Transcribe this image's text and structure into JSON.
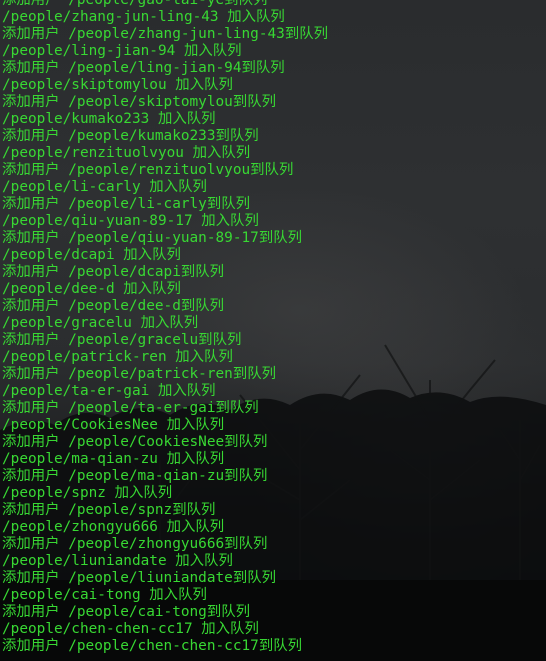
{
  "terminal": {
    "text_color": "#38d833",
    "lines": [
      "添加用户 /people/gao-tai-ye到队列",
      "/people/zhang-jun-ling-43 加入队列",
      "添加用户 /people/zhang-jun-ling-43到队列",
      "/people/ling-jian-94 加入队列",
      "添加用户 /people/ling-jian-94到队列",
      "/people/skiptomylou 加入队列",
      "添加用户 /people/skiptomylou到队列",
      "/people/kumako233 加入队列",
      "添加用户 /people/kumako233到队列",
      "/people/renzituolvyou 加入队列",
      "添加用户 /people/renzituolvyou到队列",
      "/people/li-carly 加入队列",
      "添加用户 /people/li-carly到队列",
      "/people/qiu-yuan-89-17 加入队列",
      "添加用户 /people/qiu-yuan-89-17到队列",
      "/people/dcapi 加入队列",
      "添加用户 /people/dcapi到队列",
      "/people/dee-d 加入队列",
      "添加用户 /people/dee-d到队列",
      "/people/gracelu 加入队列",
      "添加用户 /people/gracelu到队列",
      "/people/patrick-ren 加入队列",
      "添加用户 /people/patrick-ren到队列",
      "/people/ta-er-gai 加入队列",
      "添加用户 /people/ta-er-gai到队列",
      "/people/CookiesNee 加入队列",
      "添加用户 /people/CookiesNee到队列",
      "/people/ma-qian-zu 加入队列",
      "添加用户 /people/ma-qian-zu到队列",
      "/people/spnz 加入队列",
      "添加用户 /people/spnz到队列",
      "/people/zhongyu666 加入队列",
      "添加用户 /people/zhongyu666到队列",
      "/people/liuniandate 加入队列",
      "添加用户 /people/liuniandate到队列",
      "/people/cai-tong 加入队列",
      "添加用户 /people/cai-tong到队列",
      "/people/chen-chen-cc17 加入队列",
      "添加用户 /people/chen-chen-cc17到队列"
    ]
  }
}
